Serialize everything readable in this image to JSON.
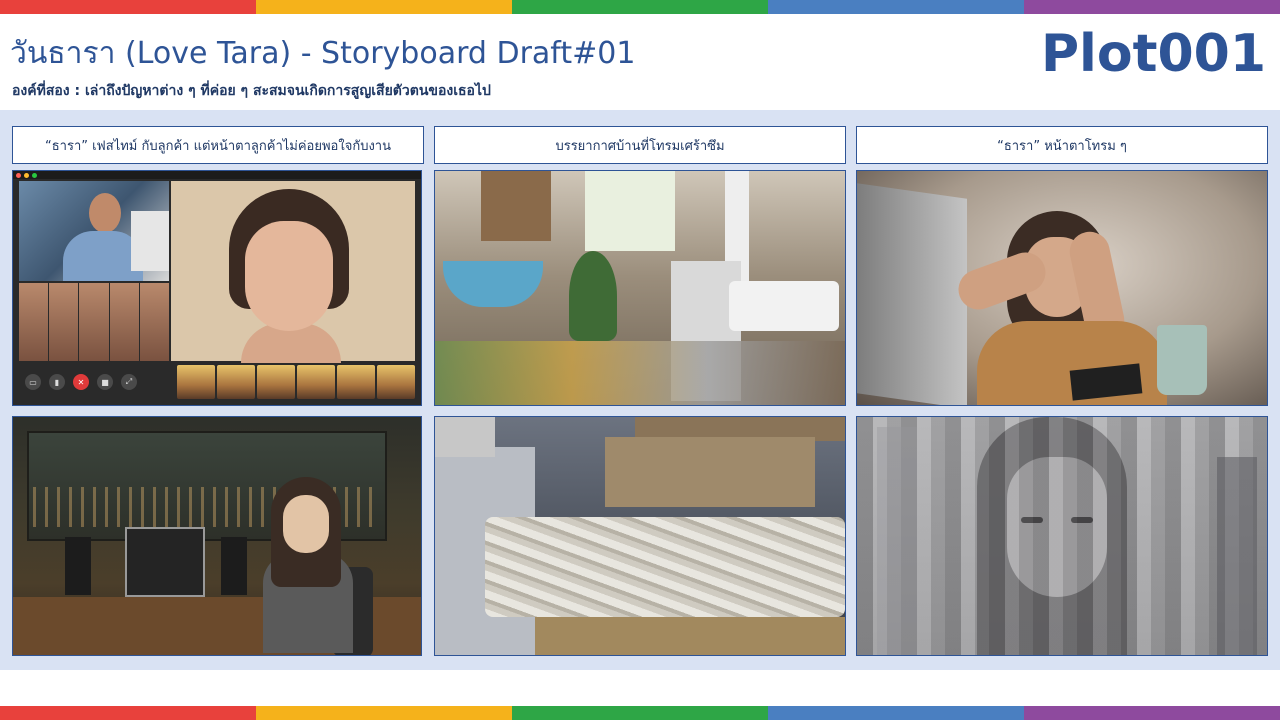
{
  "header": {
    "title": "วันธารา (Love Tara) - Storyboard Draft#01",
    "subtitle": "องค์ที่สอง : เล่าถึงปัญหาต่าง ๆ ที่ค่อย ๆ สะสมจนเกิดการสูญเสียตัวตนของเธอไป",
    "plot_id": "Plot001"
  },
  "captions": [
    "“ธารา” เฟสไทม์ กับลูกค้า แต่หน้าตาลูกค้าไม่ค่อยพอใจกับงาน",
    "บรรยากาศบ้านที่โทรมเศร้าซึม",
    "“ธารา” หน้าตาโทรม ๆ"
  ],
  "panels": [
    {
      "name": "video-call-image",
      "depicts": "video call with angry client and young woman"
    },
    {
      "name": "messy-kitchen-image",
      "depicts": "cluttered kitchen"
    },
    {
      "name": "stressed-woman-image",
      "depicts": "woman holding her head at laptop"
    },
    {
      "name": "anime-night-room-image",
      "depicts": "girl at desk by night window"
    },
    {
      "name": "messy-office-desk-image",
      "depicts": "desk piled with papers"
    },
    {
      "name": "sketch-woman-city-image",
      "depicts": "sketched woman with city overlay"
    }
  ],
  "colors": {
    "strip": [
      "#e8413c",
      "#f5b21b",
      "#2ea646",
      "#4a7fc1",
      "#8e4a9e"
    ],
    "title": "#2e5496",
    "board_bg": "#d9e2f3"
  }
}
